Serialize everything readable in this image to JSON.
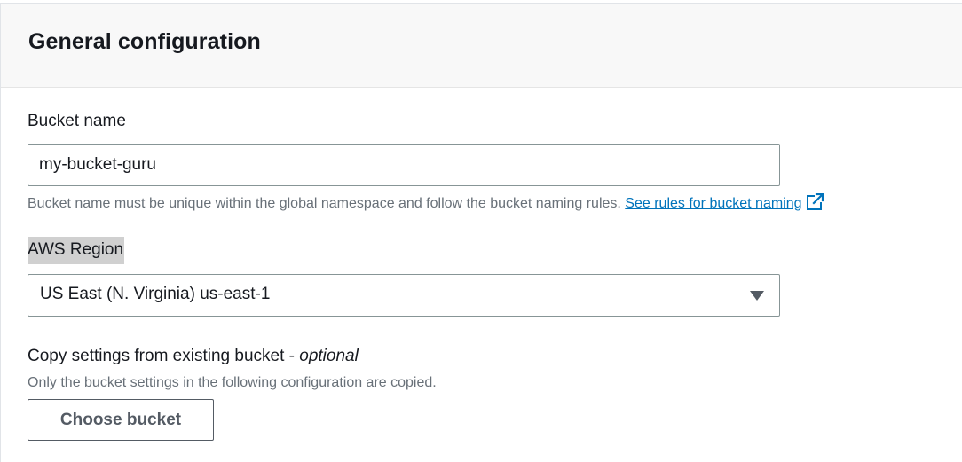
{
  "panel": {
    "title": "General configuration"
  },
  "bucket_name": {
    "label": "Bucket name",
    "value": "my-bucket-guru",
    "hint": "Bucket name must be unique within the global namespace and follow the bucket naming rules.",
    "rules_link": "See rules for bucket naming",
    "link_icon": "external-link-icon"
  },
  "region": {
    "label": "AWS Region",
    "selected": "US East (N. Virginia) us-east-1",
    "caret_icon": "caret-down-icon"
  },
  "copy_settings": {
    "label": "Copy settings from existing bucket - ",
    "optional": "optional",
    "hint": "Only the bucket settings in the following configuration are copied.",
    "button_label": "Choose bucket"
  },
  "colors": {
    "link": "#0073bb",
    "text": "#16191f",
    "hint": "#687078",
    "header_bg": "#f8f8f8",
    "input_border": "#879596",
    "highlight": "#d0d0d0"
  }
}
